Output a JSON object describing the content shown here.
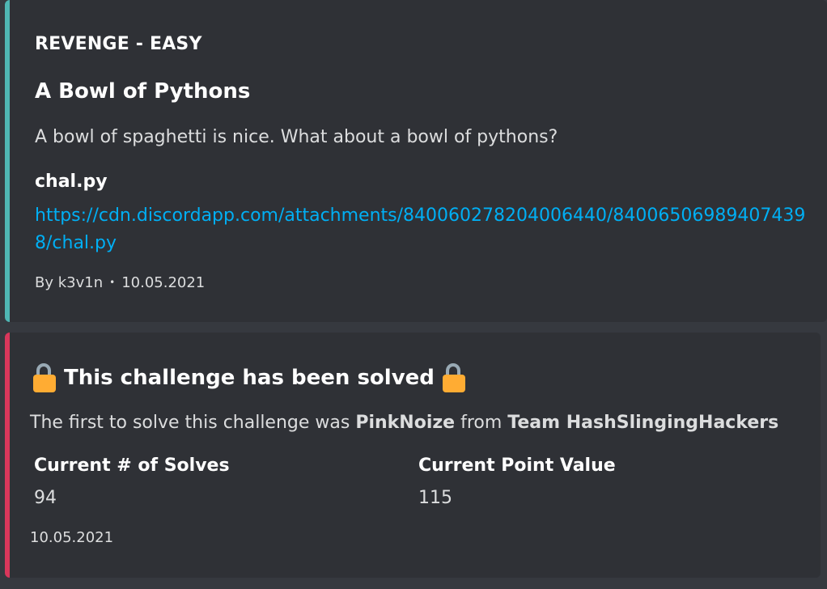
{
  "challenge_embed": {
    "accent_color": "#4fb6b4",
    "author": "REVENGE - EASY",
    "title": "A Bowl of Pythons",
    "description": "A bowl of spaghetti is nice. What about a bowl of pythons?",
    "file_field_name": "chal.py",
    "file_url": "https://cdn.discordapp.com/attachments/840060278204006440/840065069894074398/chal.py",
    "footer_author": "By k3v1n",
    "footer_separator": "•",
    "footer_date": "10.05.2021"
  },
  "solved_embed": {
    "accent_color": "#d9375b",
    "lock_icon": "open-lock-icon",
    "title": "This challenge has been solved",
    "desc_prefix": "The first to solve this challenge was ",
    "first_solver": "PinkNoize",
    "desc_mid": " from ",
    "team": "Team HashSlingingHackers",
    "fields": [
      {
        "name": "Current # of Solves",
        "value": "94"
      },
      {
        "name": "Current Point Value",
        "value": "115"
      }
    ],
    "footer_date": "10.05.2021"
  }
}
